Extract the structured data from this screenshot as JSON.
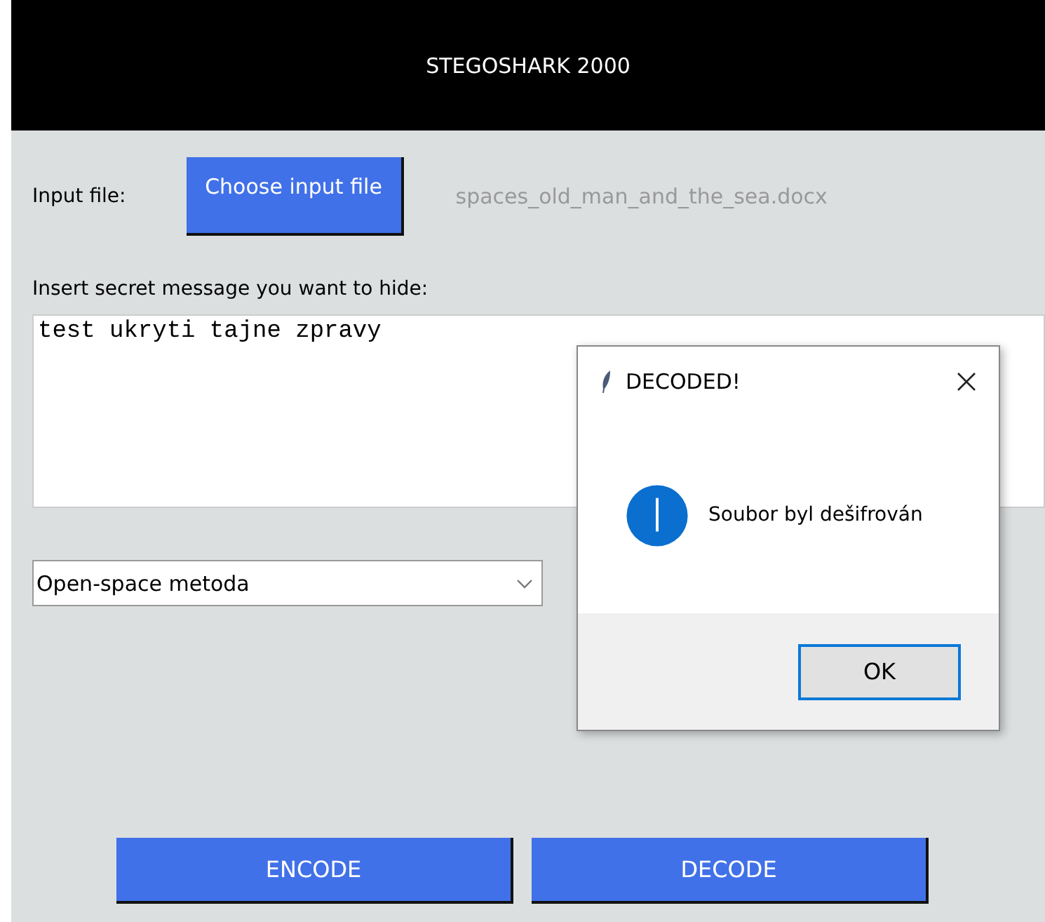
{
  "window": {
    "title": "STEGOSHARK 2000"
  },
  "input_file": {
    "label": "Input file:",
    "button": "Choose input file",
    "filename": "spaces_old_man_and_the_sea.docx"
  },
  "message": {
    "label": "Insert secret message you want to hide:",
    "value": "test ukryti tajne zpravy"
  },
  "method": {
    "value": "Open-space metoda"
  },
  "buttons": [
    "ENCODE",
    "DECODE"
  ],
  "dialog": {
    "title": "DECODED!",
    "message": "Soubor byl dešifrován",
    "button": "OK"
  }
}
